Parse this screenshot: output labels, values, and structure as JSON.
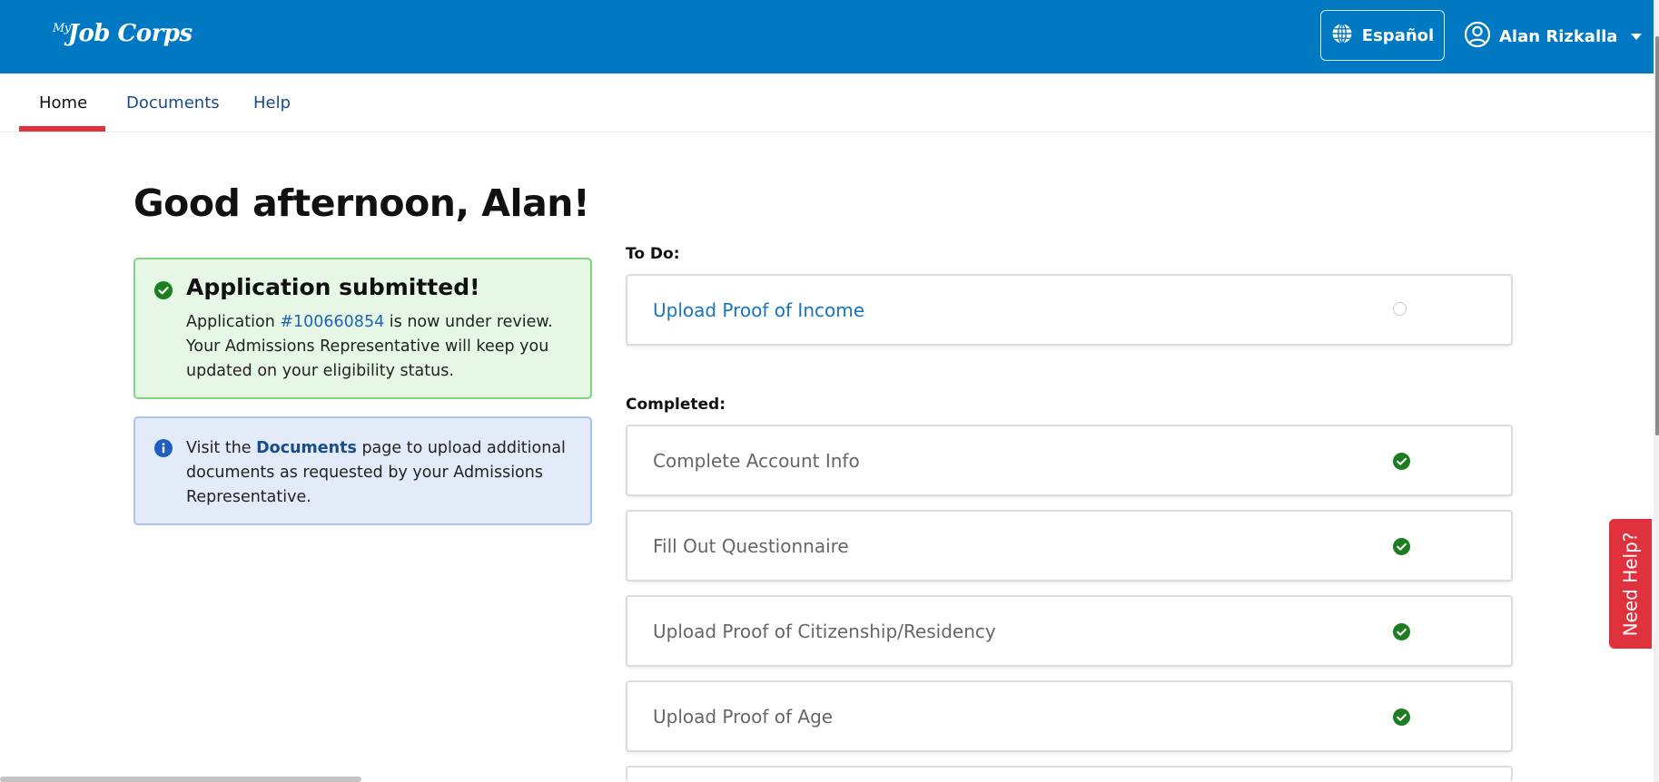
{
  "header": {
    "logo_prefix": "My",
    "logo_text": "Job Corps",
    "language_button": "Español",
    "user_name": "Alan Rizkalla",
    "brand_color": "#0079c2"
  },
  "nav": {
    "tabs": [
      {
        "label": "Home",
        "active": true
      },
      {
        "label": "Documents",
        "active": false
      },
      {
        "label": "Help",
        "active": false
      }
    ]
  },
  "greeting": "Good afternoon, Alan!",
  "success_alert": {
    "title": "Application submitted!",
    "body_prefix": "Application ",
    "application_number": "#100660854",
    "body_suffix": " is now under review. Your Admissions Representative will keep you updated on your eligibility status."
  },
  "info_alert": {
    "prefix": "Visit the ",
    "link": "Documents",
    "suffix": " page to upload additional documents as requested by your Admissions Representative."
  },
  "todo": {
    "label": "To Do:",
    "items": [
      {
        "label": "Upload Proof of Income",
        "status": "incomplete"
      }
    ]
  },
  "completed": {
    "label": "Completed:",
    "items": [
      {
        "label": "Complete Account Info",
        "status": "complete"
      },
      {
        "label": "Fill Out Questionnaire",
        "status": "complete"
      },
      {
        "label": "Upload Proof of Citizenship/Residency",
        "status": "complete"
      },
      {
        "label": "Upload Proof of Age",
        "status": "complete"
      }
    ]
  },
  "need_help": "Need Help?"
}
